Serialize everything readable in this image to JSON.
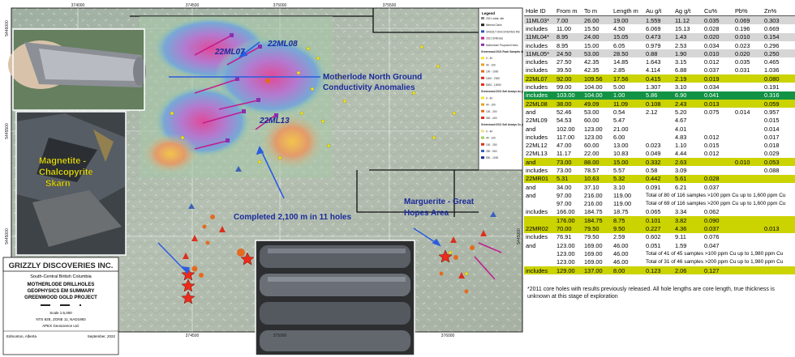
{
  "map": {
    "top_coords": [
      "374000",
      "374500",
      "375000",
      "375500"
    ],
    "bottom_coords": [
      "374500",
      "375000",
      "376000"
    ],
    "left_coords": [
      "5446000",
      "5445500",
      "5445000"
    ],
    "right_coords": [
      "5446000",
      "5445500",
      "5445000"
    ],
    "callouts": {
      "anomaly": "Motherlode North Ground Conductivity Anomalies",
      "skarn": "Magnetite - Chalcopyrite Skarn",
      "completed": "Completed 2,100 m in 11 holes",
      "marguerite": "Marguerite - Great Hopes Area"
    },
    "hole_labels": [
      "22ML07",
      "22ML08",
      "22ML13"
    ],
    "legend": {
      "title": "Legend",
      "items": [
        "2021 collar, site",
        "Mineral Claim",
        "GRIZZLY DISCOVERIES INC",
        "2021 Drillholes",
        "Motherlode Proposed Holes",
        "Greenwood 2021 Rock Samples Au g/t",
        "0 - 40",
        "40 - 100",
        "100 - 1000",
        "1000 - 2000",
        "5000 - 10000",
        "Greenwood 2011 Soil Assays Au ppb",
        "0 - 40",
        "40 - 100",
        "100 - 200",
        "300 - 400",
        "Greenwood 2011 Soil Assays Cu ppm",
        "0 - 40",
        "40 - 100",
        "100 - 250",
        "250 - 500",
        "500 - 1000"
      ]
    },
    "title_block": {
      "company": "GRIZZLY DISCOVERIES INC.",
      "region": "South-Central British Columbia",
      "line1": "MOTHERLODE DRILLHOLES",
      "line2": "GEOPHYSICS EM SUMMARY",
      "line3": "GREENWOOD GOLD PROJECT",
      "scale": "Scale 1:6,000",
      "nts": "NTS 82E, ZONE 11, NAD1983",
      "author": "APEX Geoscience Ltd.",
      "place": "Edmonton, Alberta",
      "date": "September, 2022"
    }
  },
  "table": {
    "headers": [
      "Hole ID",
      "From m",
      "To m",
      "Length m",
      "Au g/t",
      "Ag g/t",
      "Cu%",
      "Pb%",
      "Zn%"
    ],
    "rows": [
      {
        "style": "gray",
        "cells": [
          "11ML03*",
          "7.00",
          "26.00",
          "19.00",
          "1.559",
          "11.12",
          "0.035",
          "0.069",
          "0.303"
        ]
      },
      {
        "style": "",
        "cells": [
          "includes",
          "11.00",
          "15.50",
          "4.50",
          "6.069",
          "15.13",
          "0.028",
          "0.196",
          "0.669"
        ]
      },
      {
        "style": "gray",
        "cells": [
          "11ML04*",
          "8.95",
          "24.00",
          "15.05",
          "0.473",
          "1.43",
          "0.020",
          "0.010",
          "0.154"
        ]
      },
      {
        "style": "",
        "cells": [
          "includes",
          "8.95",
          "15.00",
          "6.05",
          "0.979",
          "2.53",
          "0.034",
          "0.023",
          "0.296"
        ]
      },
      {
        "style": "gray",
        "cells": [
          "11ML05*",
          "24.50",
          "53.00",
          "28.50",
          "0.88",
          "1.90",
          "0.010",
          "0.020",
          "0.250"
        ]
      },
      {
        "style": "",
        "cells": [
          "includes",
          "27.50",
          "42.35",
          "14.85",
          "1.643",
          "3.15",
          "0.012",
          "0.035",
          "0.465"
        ]
      },
      {
        "style": "",
        "cells": [
          "includes",
          "39.50",
          "42.35",
          "2.85",
          "4.114",
          "6.88",
          "0.037",
          "0.031",
          "1.036"
        ]
      },
      {
        "style": "hl",
        "cells": [
          "22ML07",
          "92.00",
          "109.56",
          "17.56",
          "0.415",
          "2.19",
          "0.019",
          "",
          "0.080"
        ]
      },
      {
        "style": "",
        "cells": [
          "includes",
          "99.00",
          "104.00",
          "5.00",
          "1.307",
          "3.10",
          "0.034",
          "",
          "0.191"
        ]
      },
      {
        "style": "hl2",
        "cells": [
          "includes",
          "103.00",
          "104.00",
          "1.00",
          "5.86",
          "6.90",
          "0.041",
          "",
          "0.316"
        ]
      },
      {
        "style": "hl",
        "cells": [
          "22ML08",
          "38.00",
          "49.09",
          "11.09",
          "0.108",
          "2.43",
          "0.013",
          "",
          "0.059"
        ]
      },
      {
        "style": "",
        "cells": [
          "and",
          "52.46",
          "53.00",
          "0.54",
          "2.12",
          "5.20",
          "0.075",
          "0.014",
          "0.957"
        ]
      },
      {
        "style": "",
        "cells": [
          "22ML09",
          "54.53",
          "60.00",
          "5.47",
          "",
          "4.67",
          "",
          "",
          "0.015"
        ]
      },
      {
        "style": "",
        "cells": [
          "and",
          "102.00",
          "123.00",
          "21.00",
          "",
          "4.01",
          "",
          "",
          "0.014"
        ]
      },
      {
        "style": "",
        "cells": [
          "includes",
          "117.00",
          "123.00",
          "6.00",
          "",
          "4.83",
          "0.012",
          "",
          "0.017"
        ]
      },
      {
        "style": "",
        "cells": [
          "22ML12",
          "47.00",
          "60.00",
          "13.00",
          "0.023",
          "1.10",
          "0.015",
          "",
          "0.018"
        ]
      },
      {
        "style": "",
        "cells": [
          "22ML13",
          "11.17",
          "22.00",
          "10.83",
          "0.049",
          "4.44",
          "0.012",
          "",
          "0.029"
        ]
      },
      {
        "style": "hl",
        "cells": [
          "and",
          "73.00",
          "88.00",
          "15.00",
          "0.332",
          "2.63",
          "",
          "0.010",
          "0.053"
        ]
      },
      {
        "style": "",
        "cells": [
          "includes",
          "73.00",
          "78.57",
          "5.57",
          "0.58",
          "3.09",
          "",
          "",
          "0.088"
        ]
      },
      {
        "style": "hl",
        "cells": [
          "22MR01",
          "5.31",
          "10.63",
          "5.32",
          "0.442",
          "5.61",
          "0.028",
          "",
          ""
        ]
      },
      {
        "style": "",
        "cells": [
          "and",
          "34.00",
          "37.10",
          "3.10",
          "0.091",
          "6.21",
          "0.037",
          "",
          ""
        ]
      },
      {
        "style": "",
        "cells": [
          "and",
          "97.00",
          "216.00",
          "119.00",
          "Total of 80 of 116 samples >100 ppm Cu up to 1,600 ppm Cu",
          "",
          "",
          "",
          ""
        ]
      },
      {
        "style": "",
        "cells": [
          "",
          "97.00",
          "216.00",
          "119.00",
          "Total of 69 of 116 samples >200 ppm Cu up to 1,600 ppm Cu",
          "",
          "",
          "",
          ""
        ]
      },
      {
        "style": "",
        "cells": [
          "includes",
          "166.00",
          "184.75",
          "18.75",
          "0.065",
          "3.34",
          "0.062",
          "",
          ""
        ]
      },
      {
        "style": "hl",
        "cells": [
          "",
          "176.00",
          "184.75",
          "8.75",
          "0.101",
          "3.82",
          "0.090",
          "",
          ""
        ]
      },
      {
        "style": "hl",
        "cells": [
          "22MR02",
          "70.00",
          "79.50",
          "9.50",
          "0.227",
          "4.36",
          "0.037",
          "",
          "0.013"
        ]
      },
      {
        "style": "",
        "cells": [
          "includes",
          "76.91",
          "79.50",
          "2.59",
          "0.602",
          "9.11",
          "0.076",
          "",
          ""
        ]
      },
      {
        "style": "",
        "cells": [
          "and",
          "123.00",
          "169.00",
          "46.00",
          "0.051",
          "1.59",
          "0.047",
          "",
          ""
        ]
      },
      {
        "style": "",
        "cells": [
          "",
          "123.00",
          "169.00",
          "46.00",
          "Total of 41 of 45 samples >100 ppm Cu up to 1,980 ppm Cu",
          "",
          "",
          "",
          ""
        ]
      },
      {
        "style": "",
        "cells": [
          "",
          "123.00",
          "169.00",
          "46.00",
          "Total of 31 of 46 samples >200 ppm Cu up to 1,980 ppm Cu",
          "",
          "",
          "",
          ""
        ]
      },
      {
        "style": "hl",
        "cells": [
          "includes",
          "129.00",
          "137.00",
          "8.00",
          "0.123",
          "2.06",
          "0.127",
          "",
          ""
        ]
      }
    ],
    "footnote": "*2011 core holes with results previously released. All hole lengths are core length, true thickness is unknown at this stage of exploration"
  }
}
